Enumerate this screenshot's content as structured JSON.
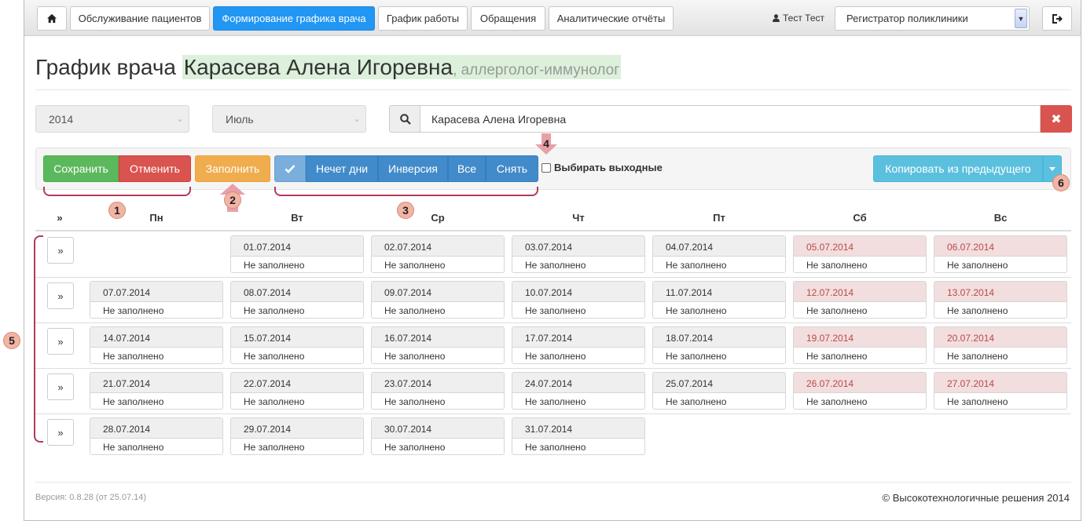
{
  "nav": {
    "home_icon": "home-icon",
    "tabs": [
      {
        "label": "Обслуживание пациентов",
        "active": false
      },
      {
        "label": "Формирование графика врача",
        "active": true
      },
      {
        "label": "График работы",
        "active": false
      },
      {
        "label": "Обращения",
        "active": false
      },
      {
        "label": "Аналитические отчёты",
        "active": false
      }
    ],
    "user_name": "Тест Тест",
    "role_select": "Регистратор поликлиники",
    "logout_icon": "logout-icon"
  },
  "title": {
    "prefix": "График врача",
    "doctor": "Карасева Алена Игоревна",
    "specialty": ", аллерголог-иммунолог"
  },
  "filters": {
    "year": "2014",
    "month": "Июль",
    "doctor_search": "Карасева Алена Игоревна"
  },
  "toolbar": {
    "save": "Сохранить",
    "cancel": "Отменить",
    "fill": "Заполнить",
    "check_icon": "check-icon",
    "odd_days": "Нечет дни",
    "inverse": "Инверсия",
    "all": "Все",
    "clear": "Снять",
    "weekends_checkbox": "Выбирать выходные",
    "copy_prev": "Копировать из предыдущего"
  },
  "callouts": [
    "1",
    "2",
    "3",
    "4",
    "5",
    "6"
  ],
  "calendar": {
    "corner": "»",
    "days": [
      "Пн",
      "Вт",
      "Ср",
      "Чт",
      "Пт",
      "Сб",
      "Вс"
    ],
    "row_button": "»",
    "empty_status": "Не заполнено",
    "weeks": [
      [
        null,
        "01.07.2014",
        "02.07.2014",
        "03.07.2014",
        "04.07.2014",
        "05.07.2014",
        "06.07.2014"
      ],
      [
        "07.07.2014",
        "08.07.2014",
        "09.07.2014",
        "10.07.2014",
        "11.07.2014",
        "12.07.2014",
        "13.07.2014"
      ],
      [
        "14.07.2014",
        "15.07.2014",
        "16.07.2014",
        "17.07.2014",
        "18.07.2014",
        "19.07.2014",
        "20.07.2014"
      ],
      [
        "21.07.2014",
        "22.07.2014",
        "23.07.2014",
        "24.07.2014",
        "25.07.2014",
        "26.07.2014",
        "27.07.2014"
      ],
      [
        "28.07.2014",
        "29.07.2014",
        "30.07.2014",
        "31.07.2014",
        null,
        null,
        null
      ]
    ]
  },
  "footer": {
    "version": "Версия: 0.8.28 (от 25.07.14)",
    "copyright": "© Высокотехнологичные решения 2014"
  },
  "colors": {
    "primary": "#2196f3",
    "success": "#5cb85c",
    "danger": "#d9534f",
    "warning": "#f0ad4e",
    "info": "#5bc0de",
    "weekend_date_bg": "#f2dede",
    "callout": "#b23a5a"
  }
}
